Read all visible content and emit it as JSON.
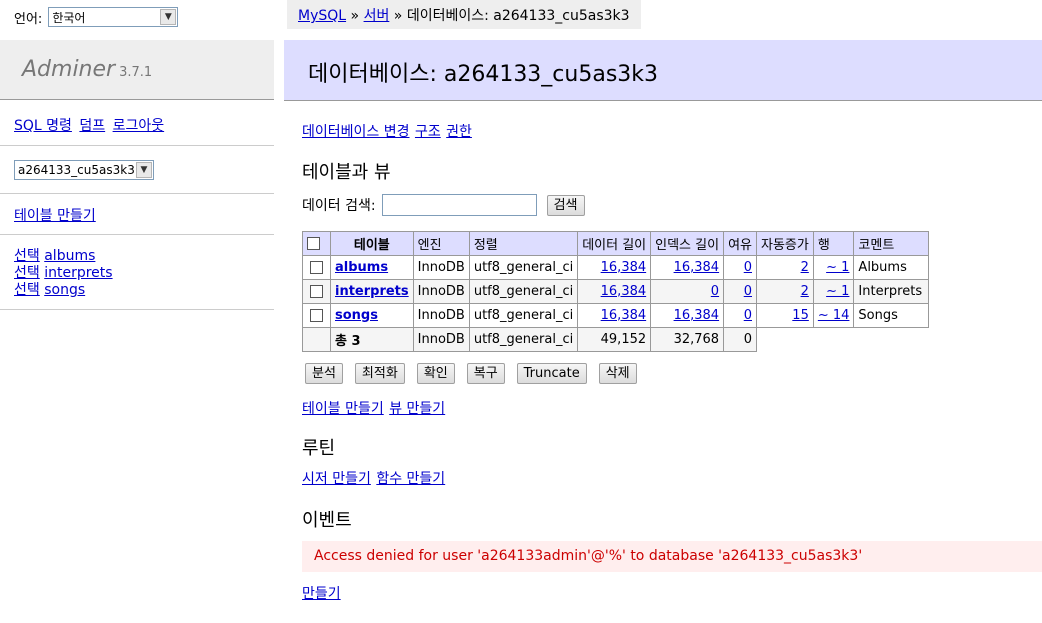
{
  "lang": {
    "label": "언어:",
    "selected": "한국어"
  },
  "sidebar": {
    "logo": "Adminer",
    "version": "3.7.1",
    "links": [
      {
        "label": "SQL 명령"
      },
      {
        "label": "덤프"
      },
      {
        "label": "로그아웃"
      }
    ],
    "db_selected": "a264133_cu5as3k3",
    "create_table": "테이블 만들기",
    "select_label": "선택",
    "tables": [
      "albums",
      "interprets",
      "songs"
    ]
  },
  "breadcrumb": {
    "items": [
      "MySQL",
      "서버"
    ],
    "sep": "»",
    "current": "데이터베이스: a264133_cu5as3k3"
  },
  "header": {
    "title": "데이터베이스: a264133_cu5as3k3"
  },
  "db_links": [
    "데이터베이스 변경",
    "구조",
    "권한"
  ],
  "tables_section": {
    "title": "테이블과 뷰",
    "search_label": "데이터 검색:",
    "search_value": "",
    "search_button": "검색",
    "columns": [
      "테이블",
      "엔진",
      "정렬",
      "데이터 길이",
      "인덱스 길이",
      "여유",
      "자동증가",
      "행",
      "코멘트"
    ],
    "rows": [
      {
        "name": "albums",
        "engine": "InnoDB",
        "collation": "utf8_general_ci",
        "data_length": "16,384",
        "index_length": "16,384",
        "free": "0",
        "auto_increment": "2",
        "rows": "~ 1",
        "comment": "Albums"
      },
      {
        "name": "interprets",
        "engine": "InnoDB",
        "collation": "utf8_general_ci",
        "data_length": "16,384",
        "index_length": "0",
        "free": "0",
        "auto_increment": "2",
        "rows": "~ 1",
        "comment": "Interprets"
      },
      {
        "name": "songs",
        "engine": "InnoDB",
        "collation": "utf8_general_ci",
        "data_length": "16,384",
        "index_length": "16,384",
        "free": "0",
        "auto_increment": "15",
        "rows": "~ 14",
        "comment": "Songs"
      }
    ],
    "total": {
      "label": "총 3",
      "engine": "InnoDB",
      "collation": "utf8_general_ci",
      "data_length": "49,152",
      "index_length": "32,768",
      "free": "0"
    },
    "actions": [
      "분석",
      "최적화",
      "확인",
      "복구",
      "Truncate",
      "삭제"
    ],
    "create_links": [
      "테이블 만들기",
      "뷰 만들기"
    ]
  },
  "routines": {
    "title": "루틴",
    "links": [
      "시저 만들기",
      "함수 만들기"
    ]
  },
  "events": {
    "title": "이벤트",
    "error": "Access denied for user 'a264133admin'@'%' to database 'a264133_cu5as3k3'",
    "create_link": "만들기"
  },
  "colors": {
    "header_bg": "#ddff",
    "link": "#0000cc",
    "error_bg": "#ffeeee",
    "error_text": "#cc0000"
  }
}
